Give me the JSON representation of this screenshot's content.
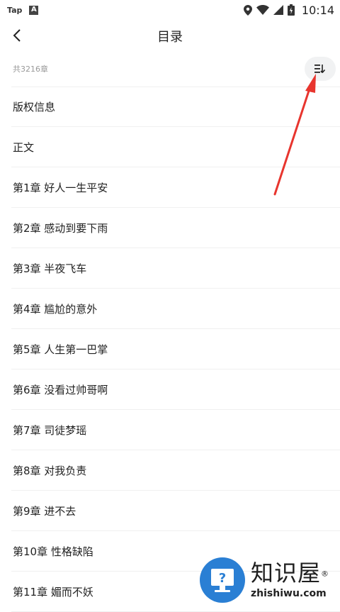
{
  "status_bar": {
    "app_label": "Tap",
    "notif_letter": "A",
    "time": "10:14"
  },
  "header": {
    "title": "目录"
  },
  "subheader": {
    "count_text": "共3216章"
  },
  "chapters": [
    "版权信息",
    "正文",
    "第1章 好人一生平安",
    "第2章 感动到要下雨",
    "第3章 半夜飞车",
    "第4章 尴尬的意外",
    "第5章 人生第一巴掌",
    "第6章 没看过帅哥啊",
    "第7章 司徒梦瑶",
    "第8章 对我负责",
    "第9章 进不去",
    "第10章 性格缺陷",
    "第11章 媚而不妖"
  ],
  "watermark": {
    "title": "知识屋",
    "url": "zhishiwu.com",
    "registered": "®"
  },
  "colors": {
    "arrow": "#e8352e",
    "watermark_blue": "#2a7fd4"
  }
}
